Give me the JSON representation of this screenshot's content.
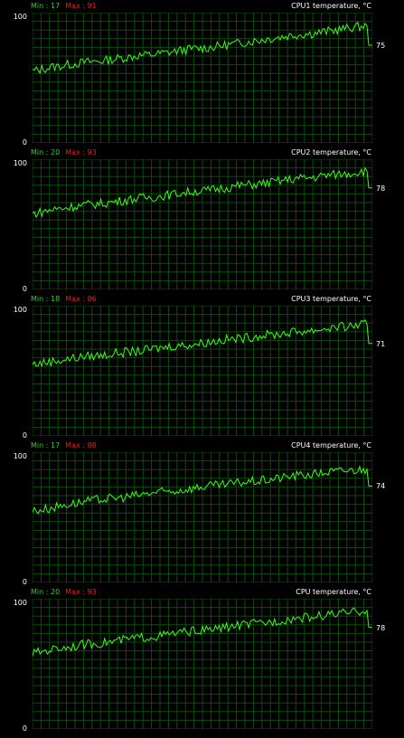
{
  "colors": {
    "background": "#000000",
    "grid": "#0b4d0b",
    "line": "#39ff14",
    "min_text": "#33cc33",
    "max_text": "#e02020",
    "label": "#ffffff"
  },
  "graphs": [
    {
      "title": "CPU1 temperature, °C",
      "min_label": "Min : 17",
      "max_label": "Max : 91",
      "y_max_label": "100",
      "y_min_label": "0",
      "current_label": "75",
      "chart_data": {
        "type": "line",
        "title": "CPU1 temperature, °C",
        "ylim": [
          0,
          100
        ],
        "grid": true,
        "values": [
          55,
          58,
          60,
          62,
          63,
          65,
          67,
          68,
          70,
          72,
          73,
          75,
          77,
          79,
          81,
          83,
          84,
          86,
          88,
          90,
          75
        ]
      }
    },
    {
      "title": "CPU2 temperature, °C",
      "min_label": "Min : 20",
      "max_label": "Max : 93",
      "y_max_label": "100",
      "y_min_label": "0",
      "current_label": "78",
      "chart_data": {
        "type": "line",
        "title": "CPU2 temperature, °C",
        "ylim": [
          0,
          100
        ],
        "grid": true,
        "values": [
          58,
          61,
          63,
          65,
          66,
          68,
          70,
          71,
          73,
          75,
          76,
          78,
          80,
          81,
          83,
          85,
          86,
          88,
          89,
          91,
          78
        ]
      }
    },
    {
      "title": "CPU3 temperature, °C",
      "min_label": "Min : 18",
      "max_label": "Max : 86",
      "y_max_label": "100",
      "y_min_label": "0",
      "current_label": "71",
      "chart_data": {
        "type": "line",
        "title": "CPU3 temperature, °C",
        "ylim": [
          0,
          100
        ],
        "grid": true,
        "values": [
          55,
          57,
          59,
          61,
          62,
          64,
          65,
          67,
          69,
          70,
          72,
          74,
          75,
          77,
          78,
          80,
          81,
          83,
          84,
          86,
          71
        ]
      }
    },
    {
      "title": "CPU4 temperature, °C",
      "min_label": "Min : 17",
      "max_label": "Max : 88",
      "y_max_label": "100",
      "y_min_label": "0",
      "current_label": "74",
      "chart_data": {
        "type": "line",
        "title": "CPU4 temperature, °C",
        "ylim": [
          0,
          100
        ],
        "grid": true,
        "values": [
          55,
          57,
          60,
          62,
          64,
          65,
          67,
          69,
          70,
          72,
          74,
          75,
          77,
          78,
          80,
          82,
          83,
          85,
          86,
          87,
          74
        ]
      }
    },
    {
      "title": "CPU temperature, °C",
      "min_label": "Min : 20",
      "max_label": "Max : 93",
      "y_max_label": "100",
      "y_min_label": "0",
      "current_label": "78",
      "chart_data": {
        "type": "line",
        "title": "CPU temperature, °C",
        "ylim": [
          0,
          100
        ],
        "grid": true,
        "values": [
          58,
          61,
          63,
          65,
          66,
          68,
          70,
          71,
          73,
          75,
          76,
          78,
          80,
          81,
          83,
          85,
          86,
          88,
          89,
          91,
          78
        ]
      }
    }
  ]
}
